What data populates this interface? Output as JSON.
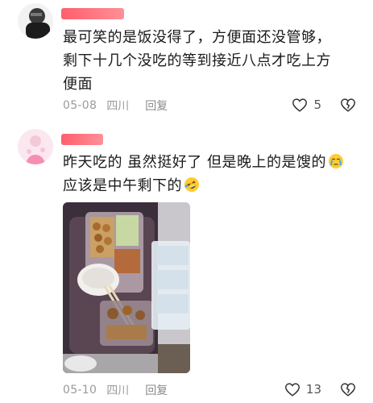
{
  "comments": [
    {
      "text_lines": [
        "最可笑的是饭没得了，方便面还没管够，",
        "剩下十几个没吃的等到接近八点才吃上方",
        "便面"
      ],
      "date": "05-08",
      "location": "四川",
      "reply_label": "回复",
      "like_count": "5"
    },
    {
      "text_lines": [
        "昨天吃的 虽然挺好了 但是晚上的是馊的",
        "应该是中午剩下的"
      ],
      "date": "05-10",
      "location": "四川",
      "reply_label": "回复",
      "like_count": "13"
    }
  ],
  "icons": {
    "like": "heart-outline-icon",
    "dislike": "broken-heart-icon",
    "emoji1": "crying-face-emoji",
    "emoji2": "rofl-face-emoji"
  },
  "colors": {
    "name_redaction": "#ff6470",
    "meta_text": "#9a9a9a",
    "body_text": "#1a1a1a"
  }
}
